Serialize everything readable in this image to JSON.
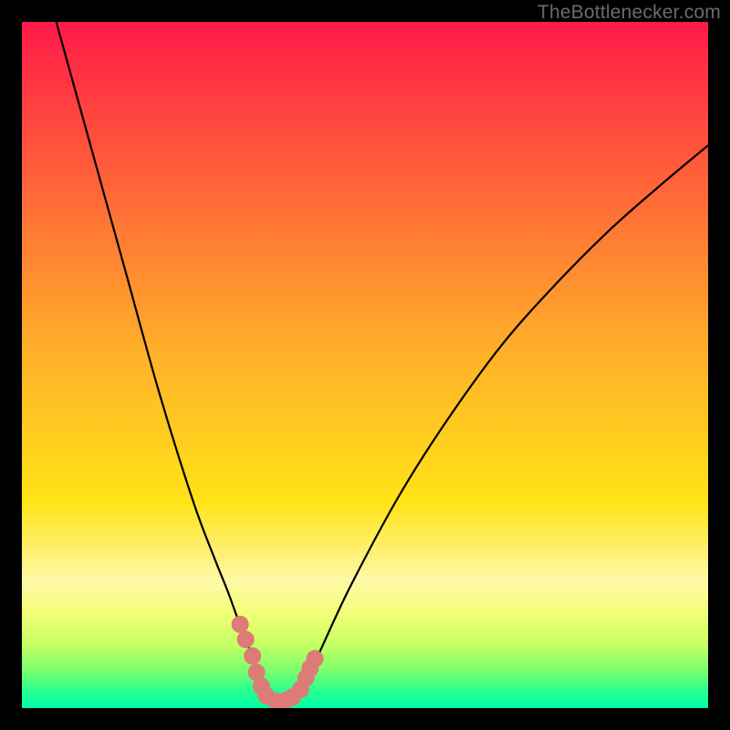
{
  "watermark": "TheBottlenecker.com",
  "chart_data": {
    "type": "line",
    "title": "",
    "xlabel": "",
    "ylabel": "",
    "xlim": [
      0,
      100
    ],
    "ylim": [
      0,
      100
    ],
    "x_min_at": 37,
    "gradient_stops": [
      {
        "offset": 0,
        "color": "#ff1a48"
      },
      {
        "offset": 0.48,
        "color": "#ffb029"
      },
      {
        "offset": 0.7,
        "color": "#ffe318"
      },
      {
        "offset": 0.815,
        "color": "#fff8a8"
      },
      {
        "offset": 0.86,
        "color": "#f3ff77"
      },
      {
        "offset": 0.905,
        "color": "#c9ff63"
      },
      {
        "offset": 0.945,
        "color": "#7eff6d"
      },
      {
        "offset": 0.975,
        "color": "#29ff91"
      },
      {
        "offset": 1.0,
        "color": "#00ffa4"
      }
    ],
    "series": [
      {
        "name": "bottleneck-curve",
        "x": [
          5,
          10,
          15,
          20,
          25,
          28,
          30,
          32,
          33,
          34,
          35,
          36,
          37,
          38,
          39,
          40,
          41,
          42,
          44,
          48,
          55,
          62,
          70,
          78,
          86,
          94,
          100
        ],
        "y": [
          100,
          82,
          64,
          46,
          30,
          22,
          17,
          11.5,
          9,
          6.5,
          4.2,
          2.3,
          1.0,
          1.0,
          1.3,
          1.9,
          3.0,
          5.0,
          9.5,
          18,
          31,
          42,
          53,
          62,
          70,
          77,
          82
        ]
      }
    ],
    "markers": [
      {
        "x": 31.8,
        "y": 12.2
      },
      {
        "x": 32.6,
        "y": 10.0
      },
      {
        "x": 33.6,
        "y": 7.6
      },
      {
        "x": 34.2,
        "y": 5.2
      },
      {
        "x": 34.9,
        "y": 3.2
      },
      {
        "x": 35.6,
        "y": 1.8
      },
      {
        "x": 37.0,
        "y": 1.0
      },
      {
        "x": 38.4,
        "y": 1.1
      },
      {
        "x": 39.4,
        "y": 1.6
      },
      {
        "x": 40.6,
        "y": 2.7
      },
      {
        "x": 41.4,
        "y": 4.4
      },
      {
        "x": 42.0,
        "y": 5.8
      },
      {
        "x": 42.7,
        "y": 7.2
      }
    ],
    "marker_color": "#dd7b77"
  }
}
